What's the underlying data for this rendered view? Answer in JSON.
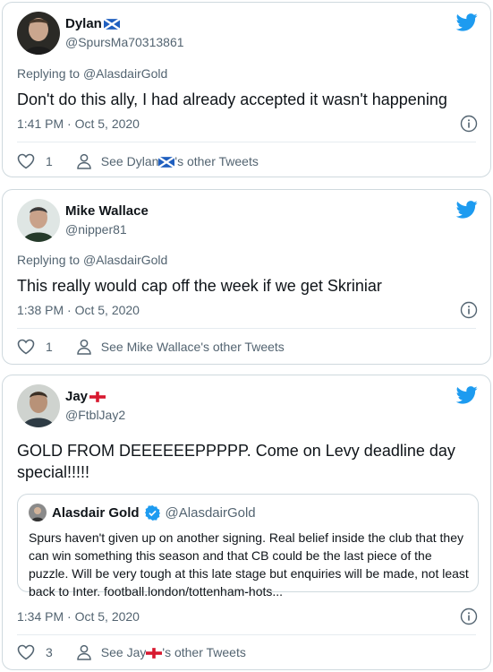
{
  "tweets": [
    {
      "name": "Dylan",
      "flag": "scotland-flag-icon",
      "handle": "@SpursMa70313861",
      "replying_prefix": "Replying to",
      "replying_to": "@AlasdairGold",
      "text": "Don't do this ally, I had already accepted it wasn't happening",
      "timestamp": "1:41 PM · Oct 5, 2020",
      "likes": "1",
      "other_prefix": "See Dylan",
      "other_suffix": "'s other Tweets"
    },
    {
      "name": "Mike Wallace",
      "handle": "@nipper81",
      "replying_prefix": "Replying to",
      "replying_to": "@AlasdairGold",
      "text": "This really would cap off the week if we get Skriniar",
      "timestamp": "1:38 PM · Oct 5, 2020",
      "likes": "1",
      "other_label": "See Mike Wallace's other Tweets"
    },
    {
      "name": "Jay",
      "flag": "england-flag-icon",
      "handle": "@FtblJay2",
      "text_line1": "GOLD FROM DEEEEEEPPPPP. Come on Levy deadline day",
      "text_line2": "special!!!!!",
      "quote": {
        "name": "Alasdair Gold",
        "handle": "@AlasdairGold",
        "text": "Spurs haven't given up on another signing. Real belief inside the club that they can win something this season and that CB could be the last piece of the puzzle. Will be very tough at this late stage but enquiries will be made, not least back to Inter. football.london/tottenham-hots..."
      },
      "timestamp": "1:34 PM · Oct 5, 2020",
      "likes": "3",
      "other_prefix": "See Jay",
      "other_suffix": "'s other Tweets"
    }
  ],
  "colors": {
    "twitter_blue": "#1d9bf0",
    "muted": "#536471",
    "border": "#cfd9de"
  }
}
